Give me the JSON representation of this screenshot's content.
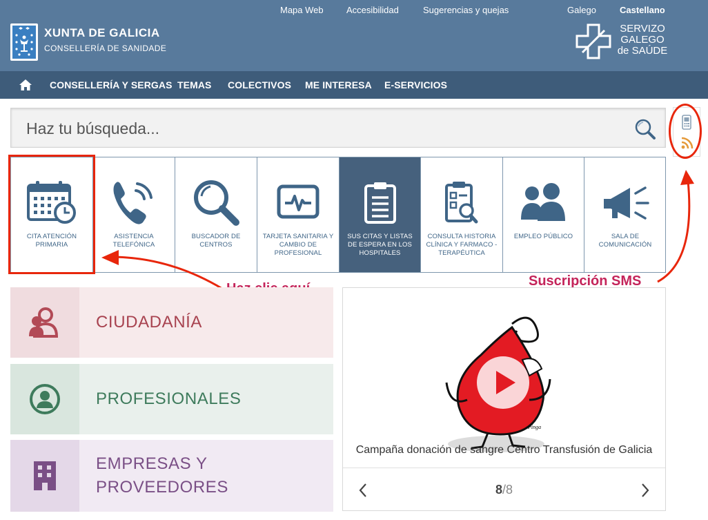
{
  "header": {
    "top_links": [
      "Mapa Web",
      "Accesibilidad",
      "Sugerencias y quejas"
    ],
    "languages": [
      "Galego",
      "Castellano"
    ],
    "brand_title": "XUNTA DE GALICIA",
    "brand_subtitle": "CONSELLERÍA DE SANIDADE",
    "sergas_line1": "SERVIZO",
    "sergas_line2": "GALEGO",
    "sergas_line3": "de SAÚDE"
  },
  "nav": {
    "items": [
      "CONSELLERÍA Y SERGAS",
      "TEMAS",
      "COLECTIVOS",
      "ME INTERESA",
      "E-SERVICIOS"
    ]
  },
  "search": {
    "placeholder": "Haz tu búsqueda..."
  },
  "tiles": [
    {
      "label": "CITA ATENCIÓN PRIMARIA",
      "icon": "calendar-clock-icon"
    },
    {
      "label": "ASISTENCIA TELEFÓNICA",
      "icon": "phone-icon"
    },
    {
      "label": "BUSCADOR DE CENTROS",
      "icon": "magnifier-icon"
    },
    {
      "label": "TARJETA SANITARIA Y CAMBIO DE PROFESIONAL",
      "icon": "health-card-icon"
    },
    {
      "label": "SUS CITAS Y LISTAS DE ESPERA EN LOS HOSPITALES",
      "icon": "clipboard-list-icon"
    },
    {
      "label": "CONSULTA HISTORIA CLÍNICA Y FARMACO - TERAPÉUTICA",
      "icon": "clinical-record-icon"
    },
    {
      "label": "EMPLEO PÚBLICO",
      "icon": "people-icon"
    },
    {
      "label": "SALA DE COMUNICACIÓN",
      "icon": "megaphone-icon"
    }
  ],
  "annotations": {
    "click_here": "Haz clic aquí",
    "sms": "Suscripción SMS"
  },
  "sections": [
    {
      "label": "CIUDADANÍA",
      "icon": "citizens-icon"
    },
    {
      "label": "PROFESIONALES",
      "icon": "professional-icon"
    },
    {
      "label_line1": "EMPRESAS Y",
      "label_line2": "PROVEEDORES",
      "icon": "building-icon"
    }
  ],
  "slider": {
    "caption": "Campaña donación de sangre Centro Transfusión de Galicia",
    "current": "8",
    "total": "/8",
    "art_signature": "Pinga"
  },
  "colors": {
    "header": "#587a9c",
    "nav": "#3e5c7a",
    "active_tile": "#46617d",
    "annotation_red": "#e8260b",
    "annotation_text": "#c4245a"
  }
}
